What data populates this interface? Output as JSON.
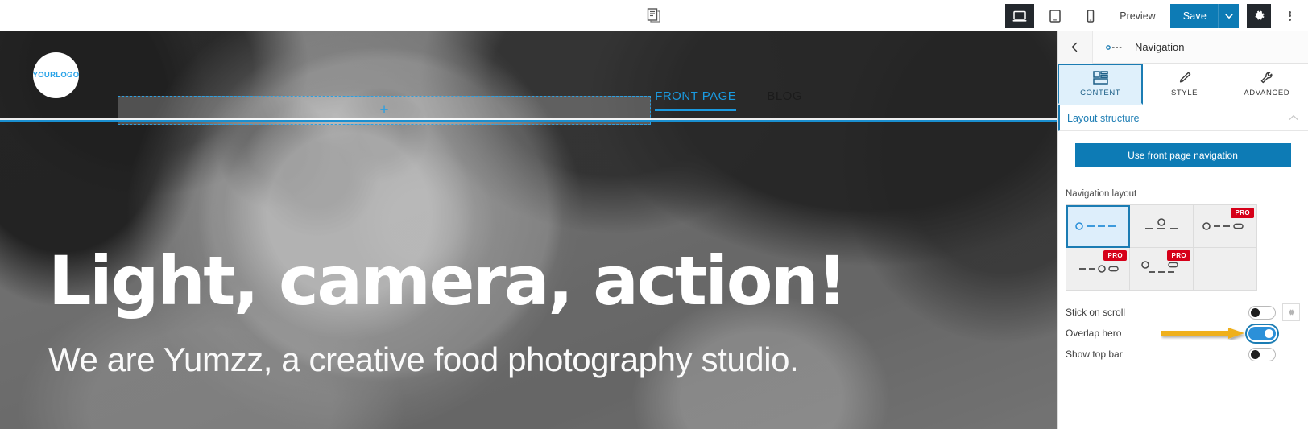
{
  "toolbar": {
    "pages_icon": "pages-icon",
    "devices": [
      {
        "name": "desktop",
        "icon": "desktop-icon",
        "active": true
      },
      {
        "name": "tablet",
        "icon": "tablet-icon",
        "active": false
      },
      {
        "name": "mobile",
        "icon": "mobile-icon",
        "active": false
      }
    ],
    "preview_label": "Preview",
    "save_label": "Save",
    "save_caret_icon": "chevron-down-icon",
    "gear_icon": "gear-icon",
    "kebab_icon": "more-vertical-icon"
  },
  "preview": {
    "logo_text": "YOURLOGO",
    "nav_links": [
      {
        "label": "FRONT PAGE",
        "active": true
      },
      {
        "label": "BLOG",
        "active": false
      }
    ],
    "block_plus": "+",
    "hero_title": "Light, camera, action!",
    "hero_subtitle": "We are Yumzz, a creative food photography studio."
  },
  "panel": {
    "back_icon": "chevron-left-icon",
    "header_icon": "navigation-icon",
    "title": "Navigation",
    "tabs": [
      {
        "label": "CONTENT",
        "icon": "layout-icon",
        "active": true
      },
      {
        "label": "STYLE",
        "icon": "brush-icon",
        "active": false
      },
      {
        "label": "ADVANCED",
        "icon": "wrench-icon",
        "active": false
      }
    ],
    "accordion": {
      "label": "Layout structure",
      "chevron_icon": "chevron-up-icon",
      "expanded": true
    },
    "use_front_page_button": "Use front page navigation",
    "navigation_layout_label": "Navigation layout",
    "pro_badge": "PRO",
    "layouts": [
      {
        "id": "logo-left-menu-right",
        "selected": true,
        "pro": false
      },
      {
        "id": "logo-center-menu-split",
        "selected": false,
        "pro": false
      },
      {
        "id": "logo-left-menu-button-right",
        "selected": false,
        "pro": true
      },
      {
        "id": "menu-left-logo-button-right",
        "selected": false,
        "pro": true
      },
      {
        "id": "logo-left-menu-below",
        "selected": false,
        "pro": true
      },
      {
        "id": "empty",
        "selected": false,
        "pro": false
      }
    ],
    "toggles": [
      {
        "label": "Stick on scroll",
        "on": false,
        "has_settings": true,
        "highlighted": false
      },
      {
        "label": "Overlap hero",
        "on": true,
        "has_settings": false,
        "highlighted": true
      },
      {
        "label": "Show top bar",
        "on": false,
        "has_settings": false,
        "highlighted": false
      }
    ]
  },
  "colors": {
    "accent_blue": "#0d7bb5",
    "link_blue": "#1a9ae0",
    "pro_red": "#d60019",
    "toggle_on": "#2b90d9",
    "annotation_arrow": "#efb01f",
    "dark": "#23282d"
  }
}
